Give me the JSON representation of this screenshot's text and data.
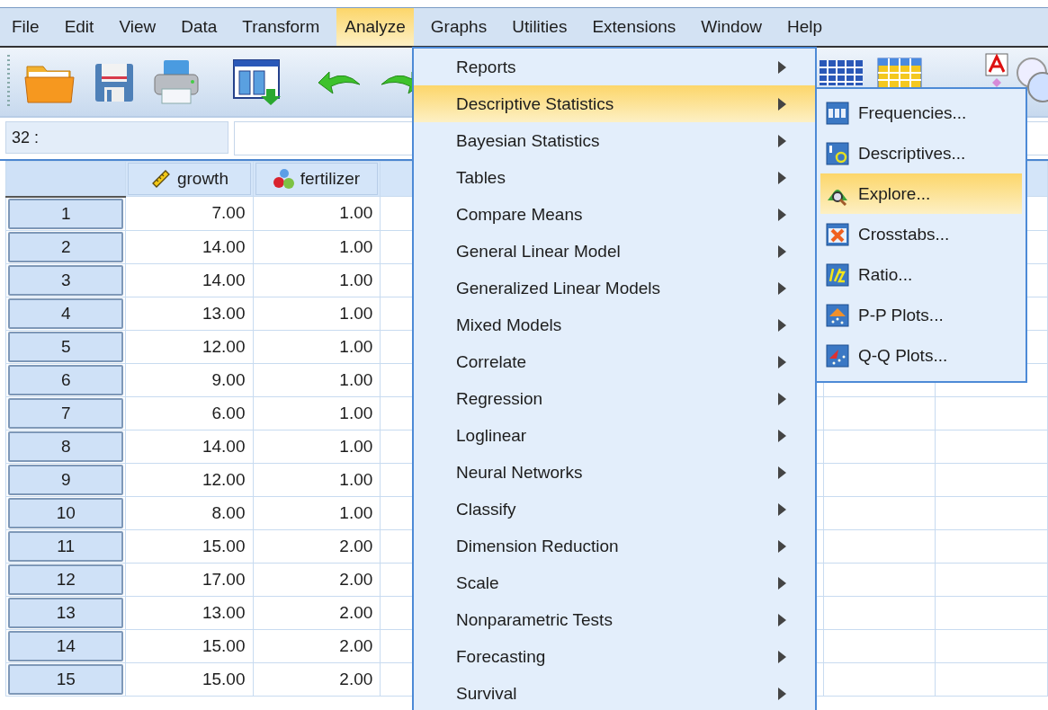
{
  "menubar": [
    {
      "label": "File",
      "selected": false
    },
    {
      "label": "Edit",
      "selected": false
    },
    {
      "label": "View",
      "selected": false
    },
    {
      "label": "Data",
      "selected": false
    },
    {
      "label": "Transform",
      "selected": false
    },
    {
      "label": "Analyze",
      "selected": true
    },
    {
      "label": "Graphs",
      "selected": false
    },
    {
      "label": "Utilities",
      "selected": false
    },
    {
      "label": "Extensions",
      "selected": false
    },
    {
      "label": "Window",
      "selected": false
    },
    {
      "label": "Help",
      "selected": false
    }
  ],
  "cell_reference": {
    "label": "32 :"
  },
  "table": {
    "columns": [
      {
        "name": "growth",
        "kind": "scale"
      },
      {
        "name": "fertilizer",
        "kind": "nominal"
      }
    ],
    "rows": [
      {
        "number": "1",
        "cells": [
          "7.00",
          "1.00"
        ]
      },
      {
        "number": "2",
        "cells": [
          "14.00",
          "1.00"
        ]
      },
      {
        "number": "3",
        "cells": [
          "14.00",
          "1.00"
        ]
      },
      {
        "number": "4",
        "cells": [
          "13.00",
          "1.00"
        ]
      },
      {
        "number": "5",
        "cells": [
          "12.00",
          "1.00"
        ]
      },
      {
        "number": "6",
        "cells": [
          "9.00",
          "1.00"
        ]
      },
      {
        "number": "7",
        "cells": [
          "6.00",
          "1.00"
        ]
      },
      {
        "number": "8",
        "cells": [
          "14.00",
          "1.00"
        ]
      },
      {
        "number": "9",
        "cells": [
          "12.00",
          "1.00"
        ]
      },
      {
        "number": "10",
        "cells": [
          "8.00",
          "1.00"
        ]
      },
      {
        "number": "11",
        "cells": [
          "15.00",
          "2.00"
        ]
      },
      {
        "number": "12",
        "cells": [
          "17.00",
          "2.00"
        ]
      },
      {
        "number": "13",
        "cells": [
          "13.00",
          "2.00"
        ]
      },
      {
        "number": "14",
        "cells": [
          "15.00",
          "2.00"
        ]
      },
      {
        "number": "15",
        "cells": [
          "15.00",
          "2.00"
        ]
      }
    ]
  },
  "analyze_menu": {
    "items": [
      {
        "label": "Reports",
        "selected": false,
        "has_submenu": true
      },
      {
        "label": "Descriptive Statistics",
        "selected": true,
        "has_submenu": true
      },
      {
        "label": "Bayesian Statistics",
        "selected": false,
        "has_submenu": true
      },
      {
        "label": "Tables",
        "selected": false,
        "has_submenu": true
      },
      {
        "label": "Compare Means",
        "selected": false,
        "has_submenu": true
      },
      {
        "label": "General Linear Model",
        "selected": false,
        "has_submenu": true
      },
      {
        "label": "Generalized Linear Models",
        "selected": false,
        "has_submenu": true
      },
      {
        "label": "Mixed Models",
        "selected": false,
        "has_submenu": true
      },
      {
        "label": "Correlate",
        "selected": false,
        "has_submenu": true
      },
      {
        "label": "Regression",
        "selected": false,
        "has_submenu": true
      },
      {
        "label": "Loglinear",
        "selected": false,
        "has_submenu": true
      },
      {
        "label": "Neural Networks",
        "selected": false,
        "has_submenu": true
      },
      {
        "label": "Classify",
        "selected": false,
        "has_submenu": true
      },
      {
        "label": "Dimension Reduction",
        "selected": false,
        "has_submenu": true
      },
      {
        "label": "Scale",
        "selected": false,
        "has_submenu": true
      },
      {
        "label": "Nonparametric Tests",
        "selected": false,
        "has_submenu": true
      },
      {
        "label": "Forecasting",
        "selected": false,
        "has_submenu": true
      },
      {
        "label": "Survival",
        "selected": false,
        "has_submenu": true
      }
    ]
  },
  "descriptive_submenu": {
    "items": [
      {
        "label": "Frequencies...",
        "selected": false,
        "kind": "frequencies"
      },
      {
        "label": "Descriptives...",
        "selected": false,
        "kind": "descriptives"
      },
      {
        "label": "Explore...",
        "selected": true,
        "kind": "explore"
      },
      {
        "label": "Crosstabs...",
        "selected": false,
        "kind": "crosstabs"
      },
      {
        "label": "Ratio...",
        "selected": false,
        "kind": "ratio"
      },
      {
        "label": "P-P Plots...",
        "selected": false,
        "kind": "pp"
      },
      {
        "label": "Q-Q Plots...",
        "selected": false,
        "kind": "qq"
      }
    ]
  }
}
